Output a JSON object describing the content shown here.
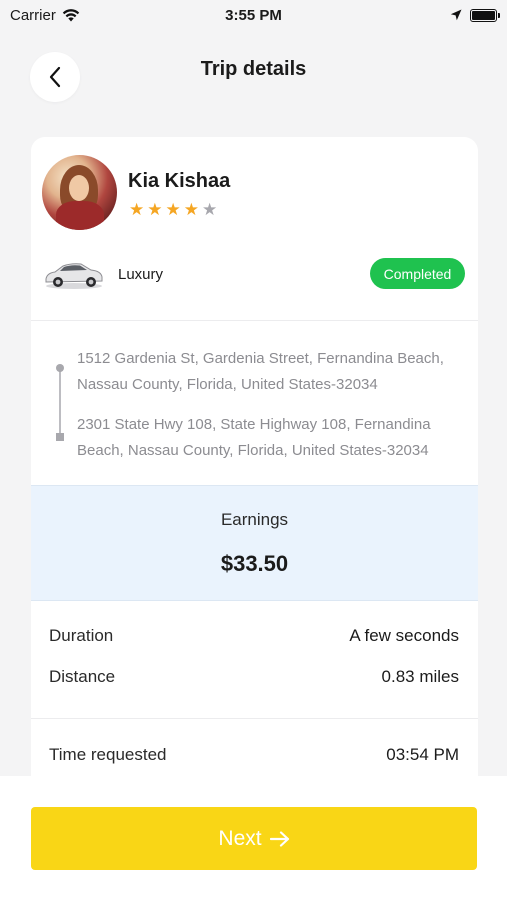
{
  "status_bar": {
    "carrier": "Carrier",
    "time": "3:55 PM"
  },
  "header": {
    "title": "Trip details",
    "back_icon": "chevron-left-icon"
  },
  "driver": {
    "name": "Kia Kishaa",
    "rating": 4,
    "rating_max": 5
  },
  "vehicle": {
    "type": "Luxury",
    "icon": "car-icon"
  },
  "trip_status": {
    "label": "Completed",
    "color": "#1fc24f"
  },
  "route": {
    "pickup": "1512 Gardenia St, Gardenia Street, Fernandina Beach, Nassau County, Florida, United States-32034",
    "dropoff": "2301 State Hwy 108, State Highway 108, Fernandina Beach, Nassau County, Florida, United States-32034"
  },
  "earnings": {
    "label": "Earnings",
    "value": "$33.50"
  },
  "details": [
    {
      "label": "Duration",
      "value": "A few seconds"
    },
    {
      "label": "Distance",
      "value": "0.83 miles"
    },
    {
      "label": "Time requested",
      "value": "03:54 PM"
    }
  ],
  "footer": {
    "next_label": "Next",
    "next_icon": "arrow-right-icon",
    "accent": "#f9d616"
  }
}
